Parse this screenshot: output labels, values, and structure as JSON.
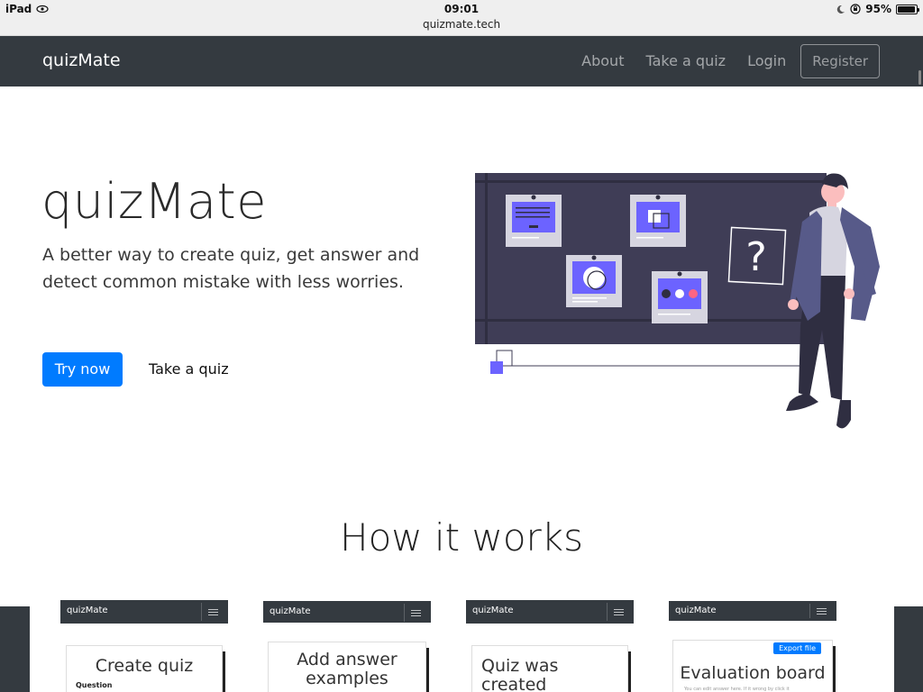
{
  "status_bar": {
    "device": "iPad",
    "time": "09:01",
    "url": "quizmate.tech",
    "battery": "95%",
    "battery_level": 0.95
  },
  "nav": {
    "brand": "quizMate",
    "links": [
      "About",
      "Take a quiz",
      "Login"
    ],
    "register": "Register"
  },
  "hero": {
    "title": "quizMate",
    "subtitle": "A better way to create quiz, get answer and detect common mistake with less worries.",
    "primary_button": "Try now",
    "secondary_link": "Take a quiz",
    "illustration_question_mark": "?"
  },
  "how_it_works": {
    "title": "How it works",
    "cards": [
      {
        "brand": "quizMate",
        "heading": "Create quiz",
        "detail": "Question"
      },
      {
        "brand": "quizMate",
        "heading": "Add answer examples",
        "detail": ""
      },
      {
        "brand": "quizMate",
        "heading": "Quiz was created",
        "detail": ""
      },
      {
        "brand": "quizMate",
        "heading": "Evaluation board",
        "detail": "You can edit answer here. If it wrong by click it",
        "badge": "Export file"
      }
    ]
  },
  "colors": {
    "navbar": "#343a40",
    "primary": "#007bff",
    "illustration_accent": "#6c63ff",
    "board": "#3f3d56"
  }
}
